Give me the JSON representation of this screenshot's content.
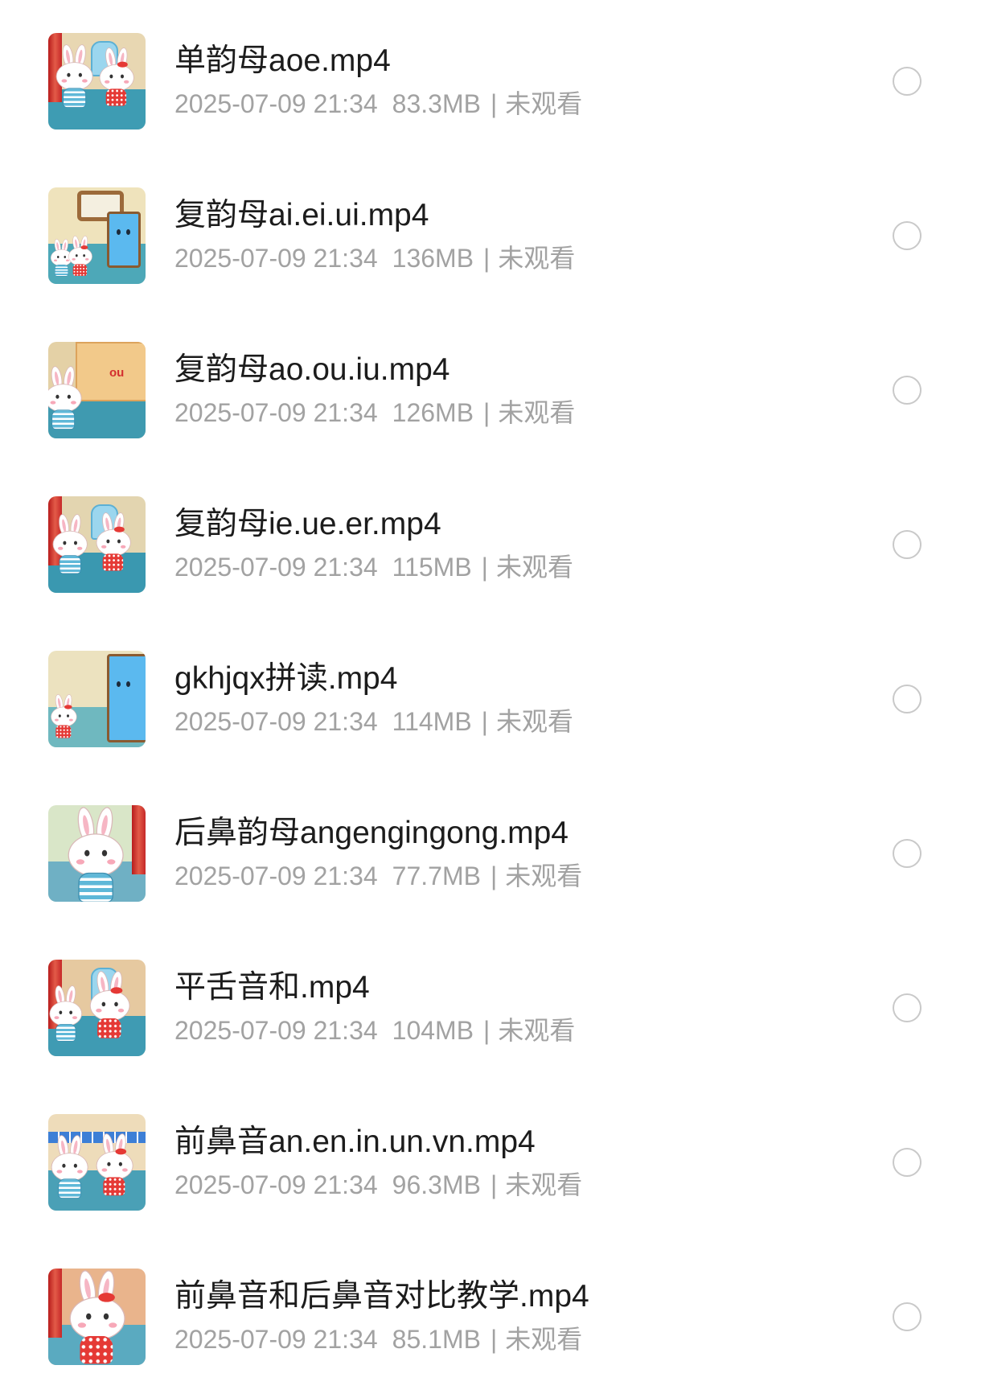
{
  "list": {
    "files": [
      {
        "title": "单韵母aoe.mp4",
        "date": "2025-07-09 21:34",
        "size": "83.3MB",
        "separator": "|",
        "status": "未观看"
      },
      {
        "title": "复韵母ai.ei.ui.mp4",
        "date": "2025-07-09 21:34",
        "size": "136MB",
        "separator": "|",
        "status": "未观看"
      },
      {
        "title": "复韵母ao.ou.iu.mp4",
        "date": "2025-07-09 21:34",
        "size": "126MB",
        "separator": "|",
        "status": "未观看",
        "thumb_label": "ou"
      },
      {
        "title": "复韵母ie.ue.er.mp4",
        "date": "2025-07-09 21:34",
        "size": "115MB",
        "separator": "|",
        "status": "未观看"
      },
      {
        "title": "gkhjqx拼读.mp4",
        "date": "2025-07-09 21:34",
        "size": "114MB",
        "separator": "|",
        "status": "未观看"
      },
      {
        "title": "后鼻韵母angengingong.mp4",
        "date": "2025-07-09 21:34",
        "size": "77.7MB",
        "separator": "|",
        "status": "未观看"
      },
      {
        "title": "平舌音和.mp4",
        "date": "2025-07-09 21:34",
        "size": "104MB",
        "separator": "|",
        "status": "未观看"
      },
      {
        "title": "前鼻音an.en.in.un.vn.mp4",
        "date": "2025-07-09 21:34",
        "size": "96.3MB",
        "separator": "|",
        "status": "未观看"
      },
      {
        "title": "前鼻音和后鼻音对比教学.mp4",
        "date": "2025-07-09 21:34",
        "size": "85.1MB",
        "separator": "|",
        "status": "未观看"
      }
    ]
  },
  "icons": {
    "select": "radio-circle-icon",
    "thumbnail": "video-thumbnail"
  },
  "colors": {
    "title": "#1c1c1c",
    "meta": "#a2a2a2",
    "checkbox_border": "#c9c9c9",
    "background": "#ffffff"
  }
}
